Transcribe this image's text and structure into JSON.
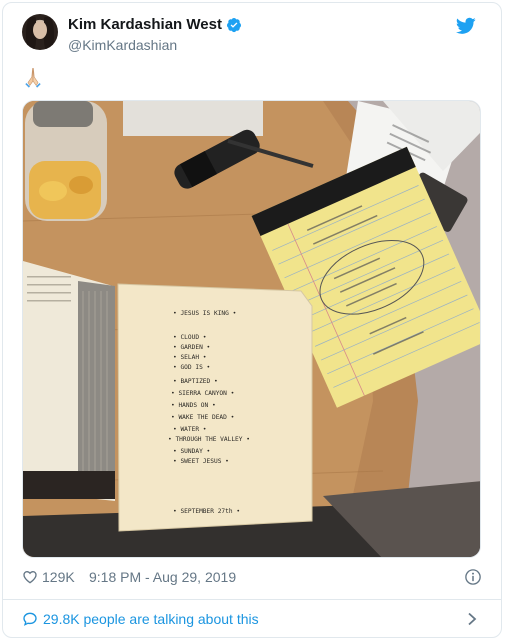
{
  "tweet": {
    "display_name": "Kim Kardashian West",
    "handle": "@KimKardashian",
    "text_emoji": "praying-hands",
    "likes": "129K",
    "timestamp": "9:18 PM - Aug 29, 2019",
    "talking": "29.8K people are talking about this"
  },
  "photo": {
    "notebook_lines": [
      "• JESUS IS KING •",
      "• CLOUD •",
      "• GARDEN •",
      "• SELAH •",
      "• GOD IS •",
      "• BAPTIZED •",
      "• SIERRA CANYON •",
      "• HANDS ON •",
      "• WAKE THE DEAD •",
      "• WATER •",
      "• THROUGH THE VALLEY •",
      "• SUNDAY •",
      "• SWEET JESUS •"
    ],
    "notebook_footer": "• SEPTEMBER 27th •"
  },
  "colors": {
    "accent": "#1da1f2",
    "link": "#1b95e0",
    "secondary_text": "#657786",
    "border": "#e1e8ed"
  }
}
